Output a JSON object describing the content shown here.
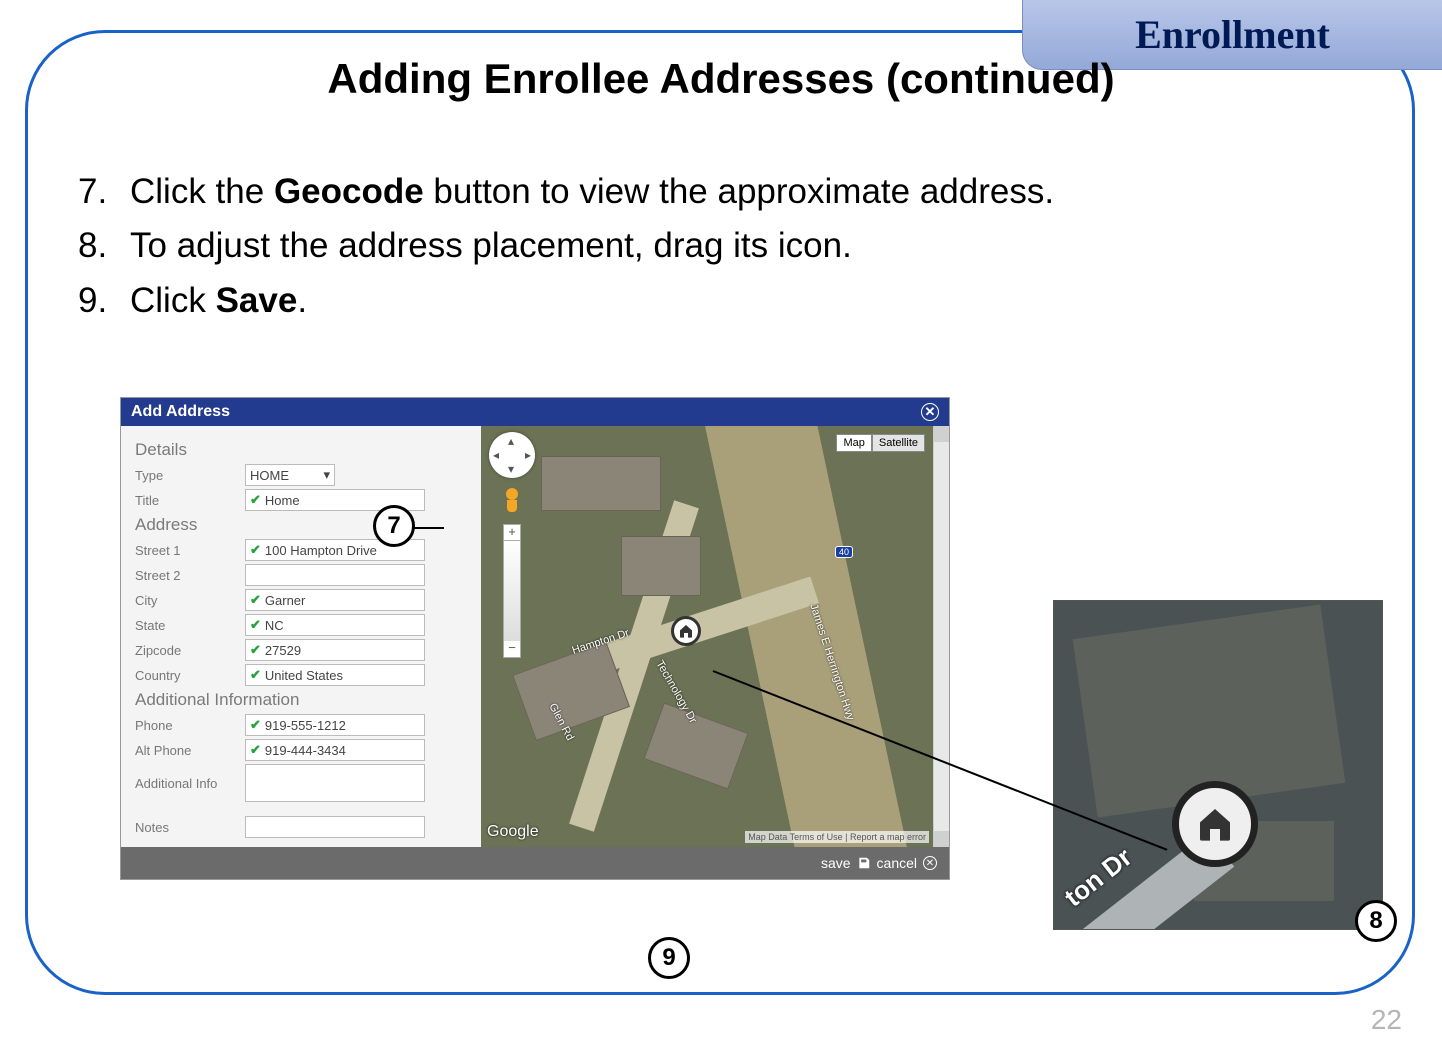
{
  "header": {
    "tab": "Enrollment"
  },
  "page": {
    "title": "Adding Enrollee Addresses (continued)",
    "number": "22"
  },
  "steps": [
    {
      "num": "7.",
      "pre": "Click the ",
      "bold": "Geocode",
      "post": " button to view the approximate address."
    },
    {
      "num": "8.",
      "pre": "To adjust the address placement, drag its icon.",
      "bold": "",
      "post": ""
    },
    {
      "num": "9.",
      "pre": "Click ",
      "bold": "Save",
      "post": "."
    }
  ],
  "dialog": {
    "title": "Add Address",
    "sections": {
      "details": "Details",
      "address": "Address",
      "additional": "Additional Information"
    },
    "labels": {
      "type": "Type",
      "title": "Title",
      "street1": "Street 1",
      "street2": "Street 2",
      "city": "City",
      "state": "State",
      "zipcode": "Zipcode",
      "country": "Country",
      "phone": "Phone",
      "altphone": "Alt Phone",
      "addinfo": "Additional Info",
      "notes": "Notes"
    },
    "values": {
      "type": "HOME",
      "title": "Home",
      "street1": "100 Hampton Drive",
      "street2": "",
      "city": "Garner",
      "state": "NC",
      "zipcode": "27529",
      "country": "United States",
      "phone": "919-555-1212",
      "altphone": "919-444-3434",
      "addinfo": "",
      "notes": ""
    },
    "map": {
      "type_buttons": {
        "map": "Map",
        "satellite": "Satellite"
      },
      "hwy": "40",
      "roads": {
        "hampton": "Hampton Dr",
        "harrington": "James E Herrington Hwy",
        "glen": "Glen Rd",
        "tech": "Technology Dr"
      },
      "logo": "Google",
      "footer": "Map Data    Terms of Use  |  Report a map error"
    },
    "footer": {
      "save": "save",
      "cancel": "cancel"
    }
  },
  "zoom": {
    "road_label": "ton Dr"
  },
  "callouts": {
    "c7": "7",
    "c8": "8",
    "c9": "9"
  }
}
